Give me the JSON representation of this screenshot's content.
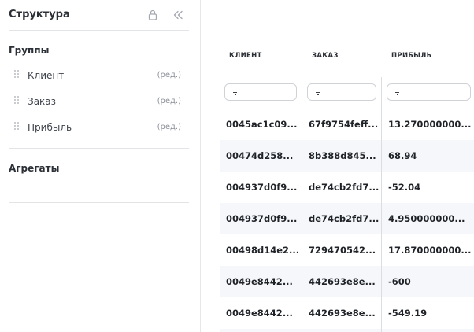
{
  "panel": {
    "title": "Структура",
    "groups_title": "Группы",
    "groups": [
      {
        "label": "Клиент",
        "edit": "(ред.)"
      },
      {
        "label": "Заказ",
        "edit": "(ред.)"
      },
      {
        "label": "Прибыль",
        "edit": "(ред.)"
      }
    ],
    "aggregates_title": "Агрегаты",
    "icons": {
      "lock": "lock-icon",
      "collapse": "double-chevron-left-icon",
      "drag": "drag-handle-icon"
    }
  },
  "grid": {
    "columns": [
      "КЛИЕНТ",
      "ЗАКАЗ",
      "ПРИБЫЛЬ"
    ],
    "rows": [
      [
        "0045ac1c09...",
        "67f9754feff...",
        "13.270000000..."
      ],
      [
        "00474d258...",
        "8b388d845...",
        "68.94"
      ],
      [
        "004937d0f9...",
        "de74cb2fd7...",
        "-52.04"
      ],
      [
        "004937d0f9...",
        "de74cb2fd7...",
        "4.950000000..."
      ],
      [
        "00498d14e2...",
        "729470542...",
        "17.870000000..."
      ],
      [
        "0049e8442...",
        "442693e8e...",
        "-600"
      ],
      [
        "0049e8442...",
        "442693e8e...",
        "-549.19"
      ]
    ]
  }
}
